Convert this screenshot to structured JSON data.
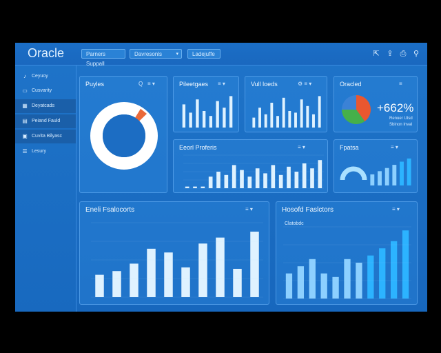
{
  "app": {
    "title": "Oracle"
  },
  "toolbar": {
    "buttons": [
      "Parners Suppall",
      "Davresonls",
      "Ladejuffe"
    ],
    "icons": [
      "share-icon",
      "upload-icon",
      "print-icon",
      "search-icon"
    ]
  },
  "sidebar": {
    "items": [
      {
        "label": "Ceyuoy",
        "icon": "note-icon"
      },
      {
        "label": "Cusvarity",
        "icon": "folder-icon"
      },
      {
        "label": "Deyatcads",
        "icon": "grid-icon"
      },
      {
        "label": "Peiand Fauld",
        "icon": "chart-icon"
      },
      {
        "label": "Cuvita Bilyasc",
        "icon": "box-icon"
      },
      {
        "label": "Lesury",
        "icon": "list-icon"
      }
    ]
  },
  "panels": {
    "donut": {
      "title": "Puyles",
      "control": "Q"
    },
    "bars1": {
      "title": "Pileetgaes",
      "control": ""
    },
    "bars2": {
      "title": "Vull loeds",
      "control": ""
    },
    "pie": {
      "title": "Oracled",
      "big_number": "+662%",
      "sub1": "Renuer Utsd",
      "sub2": "Sbinon Inval"
    },
    "wide": {
      "title": "Eeorl Proferis"
    },
    "gauge": {
      "title": "Fpatsa"
    },
    "bottom_left": {
      "title": "Eneli Fsalocorts"
    },
    "bottom_right": {
      "title": "Hosofd Faslctors",
      "subtitle": "Clatobdc"
    }
  },
  "chart_data": [
    {
      "type": "pie",
      "panel": "Puyles",
      "values": [
        96,
        4
      ],
      "colors": [
        "#ffffff",
        "#ea6a3a"
      ]
    },
    {
      "type": "bar",
      "panel": "Pileetgaes",
      "values": [
        0.7,
        0.45,
        0.85,
        0.5,
        0.35,
        0.8,
        0.6,
        0.95
      ]
    },
    {
      "type": "bar",
      "panel": "Vull loeds",
      "values": [
        0.3,
        0.6,
        0.4,
        0.75,
        0.35,
        0.9,
        0.5,
        0.45,
        0.85,
        0.65,
        0.4,
        0.95
      ]
    },
    {
      "type": "pie",
      "panel": "Oracled",
      "values": [
        40,
        35,
        25
      ],
      "colors": [
        "#e9572f",
        "#46b04a",
        "#3b82d6"
      ]
    },
    {
      "type": "bar",
      "panel": "Eeorl Proferis",
      "values": [
        0.05,
        0.05,
        0.05,
        0.35,
        0.5,
        0.4,
        0.7,
        0.55,
        0.35,
        0.6,
        0.45,
        0.7,
        0.4,
        0.65,
        0.5,
        0.75,
        0.6,
        0.85
      ]
    },
    {
      "type": "bar",
      "panel": "Fpatsa",
      "values": [
        0.35,
        0.45,
        0.55,
        0.65,
        0.75,
        0.85
      ]
    },
    {
      "type": "bar",
      "panel": "Eneli Fsalocorts",
      "values": [
        0.3,
        0.35,
        0.45,
        0.65,
        0.6,
        0.4,
        0.72,
        0.8,
        0.38,
        0.88
      ]
    },
    {
      "type": "bar",
      "panel": "Hosofd Faslctors",
      "values": [
        0.35,
        0.45,
        0.55,
        0.35,
        0.3,
        0.55,
        0.5,
        0.6,
        0.7,
        0.8,
        0.95
      ]
    }
  ],
  "colors": {
    "bar_light": "#dff2ff",
    "bar_mid": "#8dd0ff",
    "bar_bright": "#2cb3ff",
    "gauge": "#a9e0ff"
  }
}
